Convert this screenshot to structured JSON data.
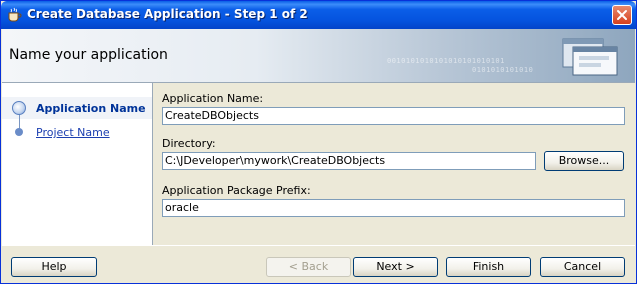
{
  "window": {
    "title": "Create Database Application - Step 1 of 2"
  },
  "header": {
    "title": "Name your application",
    "binary_1": "0010101010101010101010101",
    "binary_2": "0101010101010"
  },
  "nav": {
    "items": [
      {
        "label": "Application Name",
        "active": true
      },
      {
        "label": "Project Name",
        "active": false
      }
    ]
  },
  "form": {
    "app_name_label": "Application Name:",
    "app_name_value": "CreateDBObjects",
    "directory_label": "Directory:",
    "directory_value": "C:\\JDeveloper\\mywork\\CreateDBObjects",
    "browse_label": "Browse...",
    "prefix_label": "Application Package Prefix:",
    "prefix_value": "oracle"
  },
  "buttons": {
    "help": "Help",
    "back": "< Back",
    "next": "Next >",
    "finish": "Finish",
    "cancel": "Cancel"
  }
}
